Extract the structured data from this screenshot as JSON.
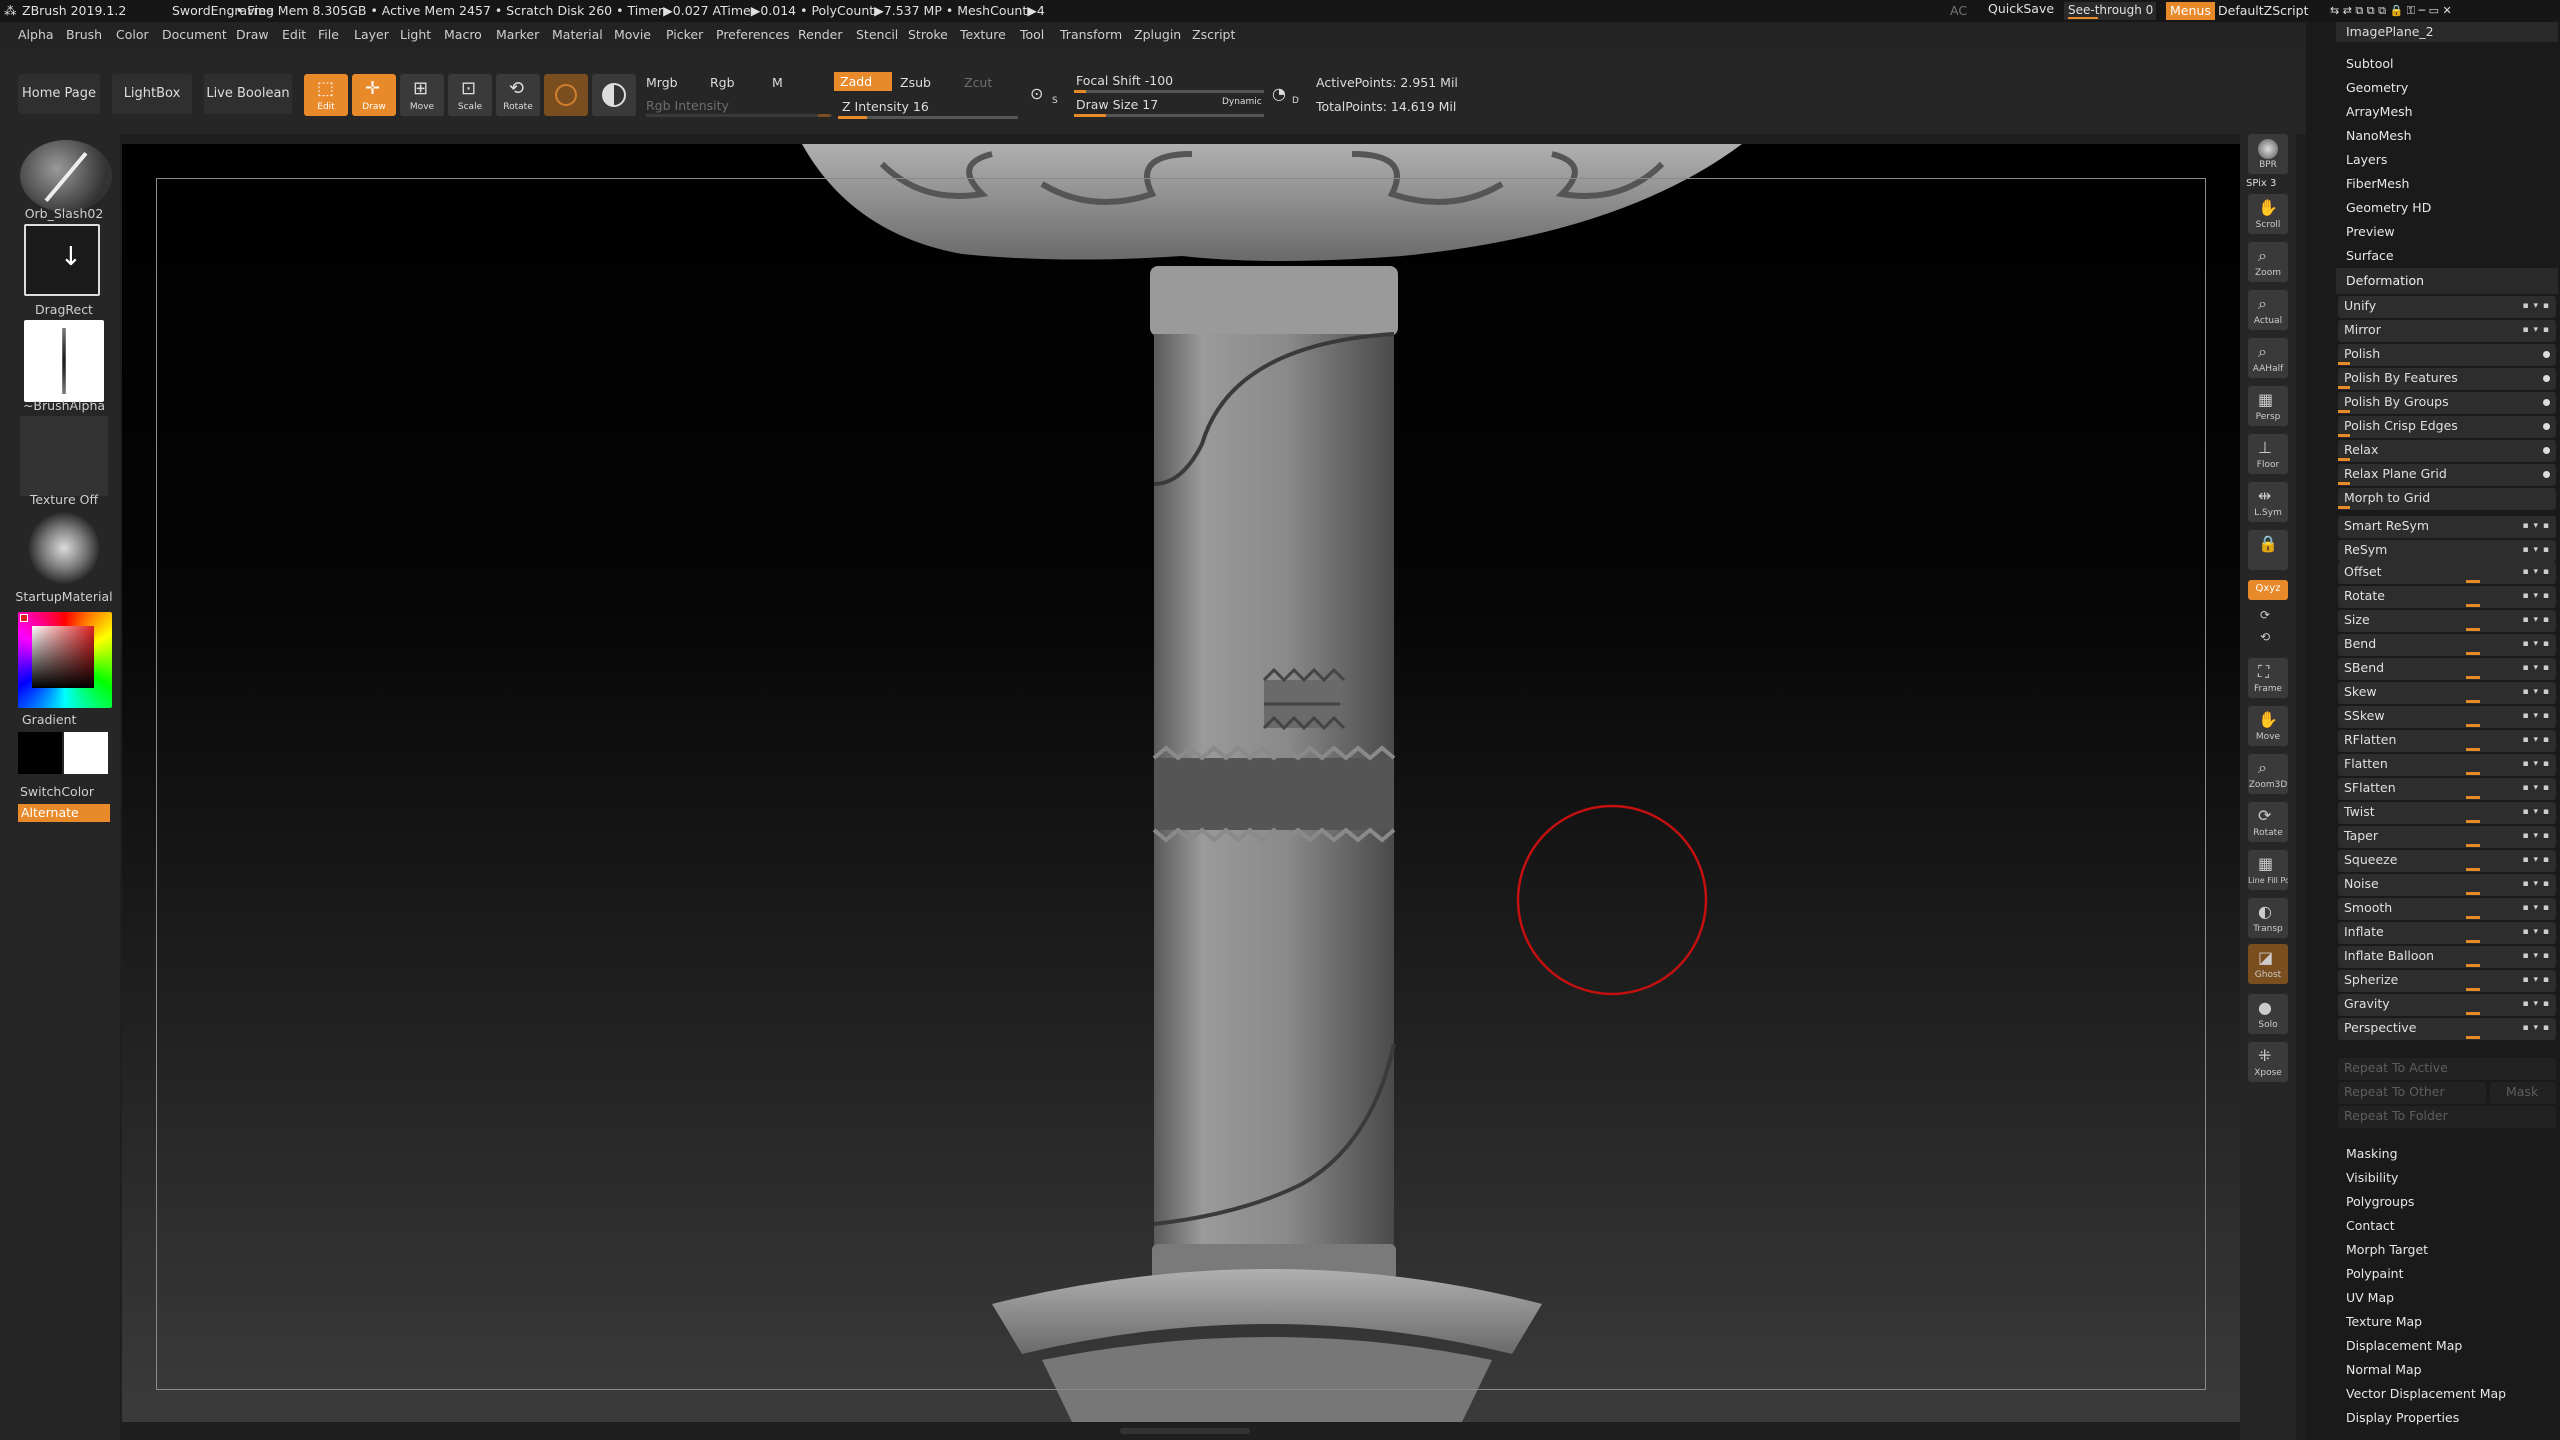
{
  "titlebar": {
    "app": "ZBrush 2019.1.2",
    "project": "SwordEngraving",
    "stats": ". • Free Mem 8.305GB • Active Mem 2457 • Scratch Disk 260 • Timer▶0.027 ATime▶0.014 • PolyCount▶7.537 MP • MeshCount▶4",
    "ac": "AC",
    "quicksave": "QuickSave",
    "seethrough": "See-through  0",
    "menus": "Menus",
    "script": "DefaultZScript"
  },
  "menubar": [
    "Alpha",
    "Brush",
    "Color",
    "Document",
    "Draw",
    "Edit",
    "File",
    "Layer",
    "Light",
    "Macro",
    "Marker",
    "Material",
    "Movie",
    "Picker",
    "Preferences",
    "Render",
    "Stencil",
    "Stroke",
    "Texture",
    "Tool",
    "Transform",
    "Zplugin",
    "Zscript"
  ],
  "shelf": {
    "home": "Home Page",
    "lightbox": "LightBox",
    "liveboolean": "Live Boolean",
    "edit": "Edit",
    "draw": "Draw",
    "move": "Move",
    "scale": "Scale",
    "rotate": "Rotate",
    "mrgb": "Mrgb",
    "rgb": "Rgb",
    "m": "M",
    "rgb_intensity": "Rgb Intensity",
    "zadd": "Zadd",
    "zsub": "Zsub",
    "zcut": "Zcut",
    "z_intensity": "Z Intensity 16",
    "focal_shift": "Focal Shift -100",
    "draw_size": "Draw Size 17",
    "dynamic": "Dynamic",
    "active_points": "ActivePoints: 2.951 Mil",
    "total_points": "TotalPoints: 14.619 Mil",
    "s": "S",
    "d": "D",
    "z_intensity_level": 0.16,
    "focal_shift_level": 0.0,
    "draw_size_level": 0.17
  },
  "leftpanel": {
    "brush": "Orb_Slash02",
    "stroke": "DragRect",
    "alpha": "~BrushAlpha",
    "texture": "Texture Off",
    "material": "StartupMaterial",
    "gradient": "Gradient",
    "switchcolor": "SwitchColor",
    "alternate": "Alternate"
  },
  "rightshelf": [
    "BPR",
    "SPix 3",
    "Scroll",
    "Zoom",
    "Actual",
    "AAHalf",
    "Persp",
    "Floor",
    "L.Sym",
    "",
    "Qxyz",
    "",
    "",
    "Frame",
    "Move",
    "Zoom3D",
    "Rotate",
    "Line Fill PolyF",
    "Transp",
    "Ghost",
    "Solo",
    "Xpose"
  ],
  "tray": {
    "top": "ImagePlane_2",
    "headers_top": [
      "Subtool",
      "Geometry",
      "ArrayMesh",
      "NanoMesh",
      "Layers",
      "FiberMesh",
      "Geometry HD",
      "Preview",
      "Surface"
    ],
    "section": "Deformation",
    "rows": [
      {
        "label": "Unify",
        "kind": "xyz"
      },
      {
        "label": "Mirror",
        "kind": "xyz"
      },
      {
        "label": "Polish",
        "kind": "dot"
      },
      {
        "label": "Polish By Features",
        "kind": "dot"
      },
      {
        "label": "Polish By Groups",
        "kind": "dot"
      },
      {
        "label": "Polish Crisp Edges",
        "kind": "dot"
      },
      {
        "label": "Relax",
        "kind": "dot"
      },
      {
        "label": "Relax Plane Grid",
        "kind": "dot"
      },
      {
        "label": "Morph to Grid",
        "kind": "none"
      },
      {
        "label": "Smart ReSym",
        "kind": "xyz"
      },
      {
        "label": "ReSym",
        "kind": "xyz"
      },
      {
        "label": "Offset",
        "kind": "slider"
      },
      {
        "label": "Rotate",
        "kind": "slider"
      },
      {
        "label": "Size",
        "kind": "slider"
      },
      {
        "label": "Bend",
        "kind": "slider"
      },
      {
        "label": "SBend",
        "kind": "slider"
      },
      {
        "label": "Skew",
        "kind": "slider"
      },
      {
        "label": "SSkew",
        "kind": "slider"
      },
      {
        "label": "RFlatten",
        "kind": "slider"
      },
      {
        "label": "Flatten",
        "kind": "slider"
      },
      {
        "label": "SFlatten",
        "kind": "slider"
      },
      {
        "label": "Twist",
        "kind": "slider"
      },
      {
        "label": "Taper",
        "kind": "slider"
      },
      {
        "label": "Squeeze",
        "kind": "slider"
      },
      {
        "label": "Noise",
        "kind": "slider"
      },
      {
        "label": "Smooth",
        "kind": "slider"
      },
      {
        "label": "Inflate",
        "kind": "slider"
      },
      {
        "label": "Inflate Balloon",
        "kind": "slider"
      },
      {
        "label": "Spherize",
        "kind": "slider"
      },
      {
        "label": "Gravity",
        "kind": "slider"
      },
      {
        "label": "Perspective",
        "kind": "slider"
      }
    ],
    "repeat": [
      "Repeat To Active",
      "Repeat To Other",
      "Repeat To Folder"
    ],
    "mask": "Mask",
    "headers_bottom": [
      "Masking",
      "Visibility",
      "Polygroups",
      "Contact",
      "Morph Target",
      "Polypaint",
      "UV Map",
      "Texture Map",
      "Displacement Map",
      "Normal Map",
      "Vector Displacement Map",
      "Display Properties"
    ]
  },
  "colors": {
    "accent": "#e8892a",
    "panel": "#262626",
    "tray": "#1a1a1a"
  }
}
